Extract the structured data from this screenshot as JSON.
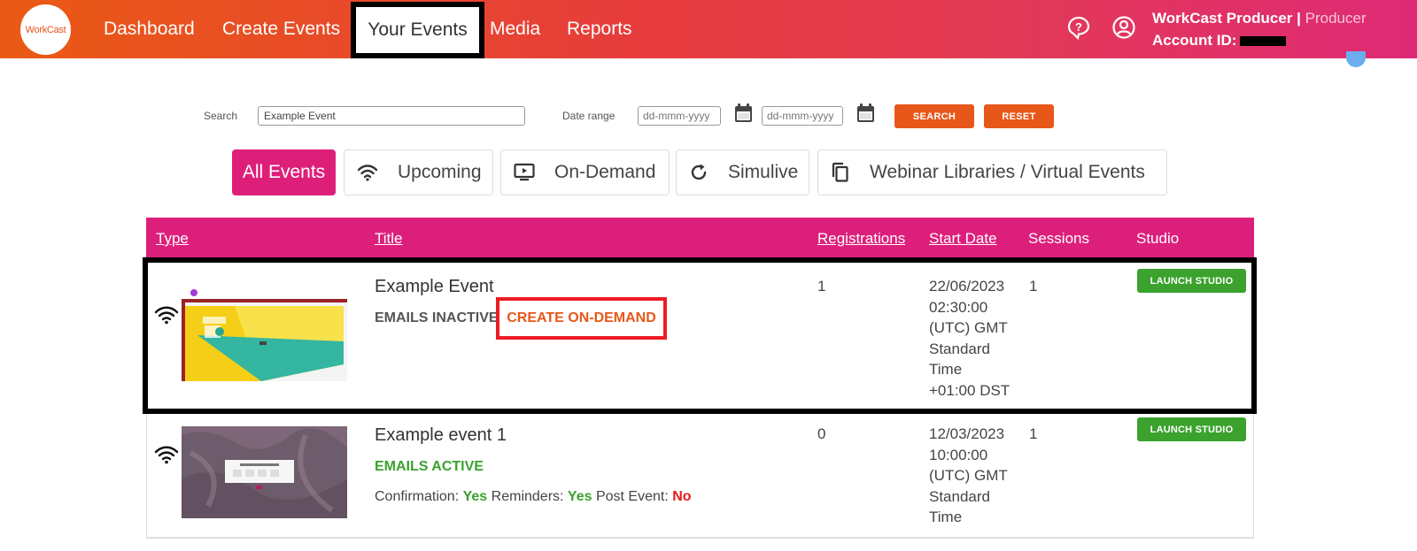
{
  "app": {
    "logo_text": "WorkCast"
  },
  "nav": {
    "items": [
      "Dashboard",
      "Create Events",
      "Media",
      "Reports"
    ],
    "active": "Your Events"
  },
  "user": {
    "name": "WorkCast Producer",
    "separator": "|",
    "role": "Producer",
    "account_label": "Account ID:"
  },
  "search": {
    "label": "Search",
    "value": "Example Event",
    "date_label": "Date range",
    "date_from_placeholder": "dd-mmm-yyyy",
    "date_to_placeholder": "dd-mmm-yyyy",
    "search_button": "SEARCH",
    "reset_button": "RESET"
  },
  "tabs": {
    "all": "All Events",
    "upcoming": "Upcoming",
    "on_demand": "On-Demand",
    "simulive": "Simulive",
    "libraries": "Webinar Libraries / Virtual Events"
  },
  "table": {
    "headers": {
      "type": "Type",
      "title": "Title",
      "registrations": "Registrations",
      "start_date": "Start Date",
      "sessions": "Sessions",
      "studio": "Studio"
    },
    "rows": [
      {
        "title": "Example Event",
        "emails": "EMAILS INACTIVE",
        "create_od": "CREATE ON-DEMAND",
        "registrations": "1",
        "date_lines": [
          "22/06/2023",
          "02:30:00",
          "(UTC) GMT",
          "Standard",
          "Time",
          "+01:00 DST"
        ],
        "sessions": "1",
        "launch": "LAUNCH STUDIO"
      },
      {
        "title": "Example event 1",
        "emails": "EMAILS ACTIVE",
        "registrations": "0",
        "date_lines": [
          "12/03/2023",
          "10:00:00",
          "(UTC) GMT",
          "Standard",
          "Time"
        ],
        "sessions": "1",
        "launch": "LAUNCH STUDIO",
        "confirmation_label": "Confirmation:",
        "confirmation": "Yes",
        "reminders_label": "Reminders:",
        "reminders": "Yes",
        "post_event_label": "Post Event:",
        "post_event": "No"
      }
    ]
  },
  "colors": {
    "brand_orange": "#e8571a",
    "brand_pink": "#dd1f7c",
    "green": "#3aa22d",
    "red": "#e21b1b"
  }
}
